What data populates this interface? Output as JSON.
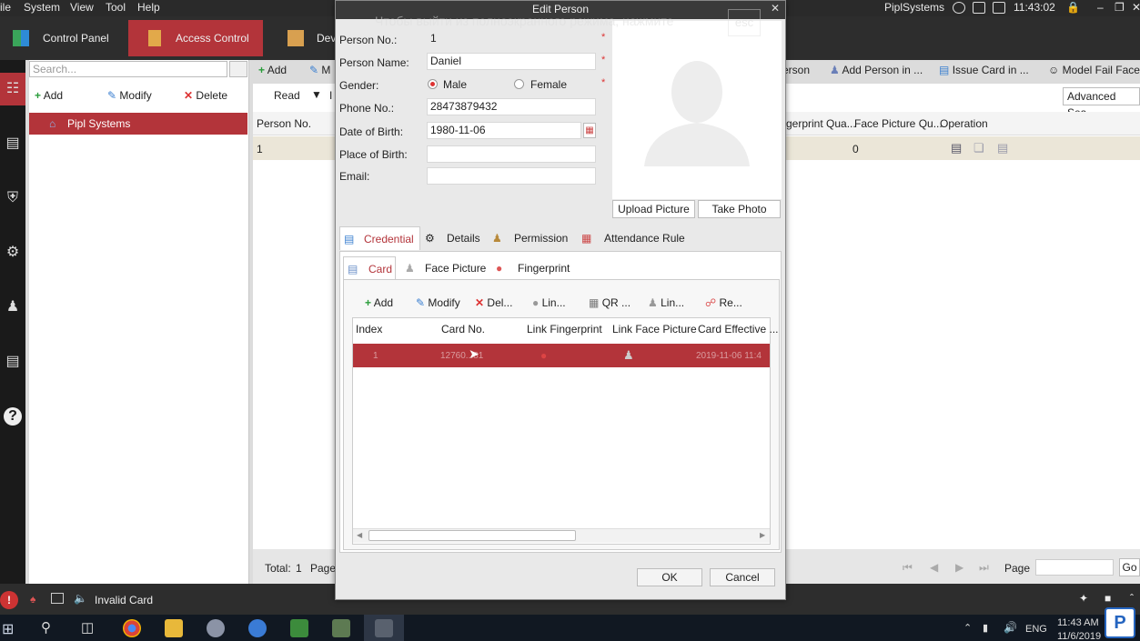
{
  "menubar": {
    "items": [
      "ile",
      "System",
      "View",
      "Tool",
      "Help"
    ],
    "app_name": "PiplSystems",
    "clock": "11:43:02"
  },
  "tabs": {
    "control_panel": "Control Panel",
    "access_control": "Access Control",
    "device": "Dev"
  },
  "left_panel": {
    "search_placeholder": "Search...",
    "add": "Add",
    "modify": "Modify",
    "delete": "Delete",
    "tree_item": "Pipl Systems"
  },
  "main": {
    "toolbar": {
      "add": "Add",
      "modify_partial": "M",
      "read": "Read",
      "i_partial": "I",
      "person_partial": "erson",
      "add_person_in": "Add Person in ...",
      "issue_card_in": "Issue Card in ...",
      "model_fail_face": "Model Fail Face",
      "advanced_search": "Advanced Sea..."
    },
    "grid": {
      "columns": [
        "Person No.",
        "gerprint Qua...",
        "Face Picture Qu...",
        "Operation"
      ],
      "row": {
        "person_no": "1",
        "face_count": "0"
      }
    },
    "footer": {
      "total_label": "Total:",
      "total_value": "1",
      "page_partial": "Page",
      "page_label": "Page",
      "go": "Go"
    }
  },
  "overlay": {
    "fullscreen_tip": "Чтобы выйти из полноэкранного режима, нажмите",
    "esc": "esc"
  },
  "dialog": {
    "title": "Edit Person",
    "fields": {
      "person_no_label": "Person No.:",
      "person_no_value": "1",
      "person_name_label": "Person Name:",
      "person_name_value": "Daniel",
      "gender_label": "Gender:",
      "male": "Male",
      "female": "Female",
      "phone_label": "Phone No.:",
      "phone_value": "28473879432",
      "dob_label": "Date of Birth:",
      "dob_value": "1980-11-06",
      "pob_label": "Place of Birth:",
      "email_label": "Email:",
      "required_mark": "*"
    },
    "upload_picture": "Upload Picture",
    "take_photo": "Take Photo",
    "tabs": [
      "Credential",
      "Details",
      "Permission",
      "Attendance Rule"
    ],
    "subtabs": [
      "Card",
      "Face Picture",
      "Fingerprint"
    ],
    "card_toolbar": [
      "Add",
      "Modify",
      "Del...",
      "Lin...",
      "QR ...",
      "Lin...",
      "Re..."
    ],
    "card_columns": [
      "Index",
      "Card No.",
      "Link Fingerprint",
      "Link Face Picture",
      "Card Effective ..."
    ],
    "card_row": {
      "index": "1",
      "card_no": "12760...81",
      "effective": "2019-11-06 11:4"
    },
    "ok": "OK",
    "cancel": "Cancel"
  },
  "statusbar": {
    "message": "Invalid Card"
  },
  "taskbar": {
    "lang": "ENG",
    "time": "11:43 AM",
    "date": "11/6/2019"
  },
  "colors": {
    "accent": "#b3343a"
  }
}
